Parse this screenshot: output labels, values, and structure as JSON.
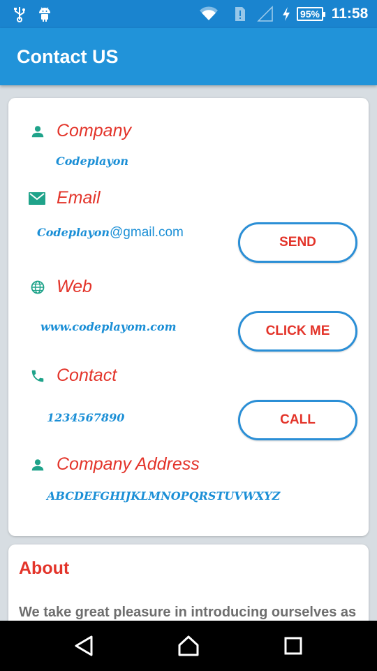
{
  "status_bar": {
    "battery": "95%",
    "time": "11:58"
  },
  "app_bar": {
    "title": "Contact US"
  },
  "contact_card": {
    "company": {
      "label": "Company",
      "value": "Codeplayon"
    },
    "email": {
      "label": "Email",
      "value_prefix": "Codeplayon",
      "value_suffix": "@gmail.com",
      "button": "SEND"
    },
    "web": {
      "label": "Web",
      "value": "www.codeplayom.com",
      "button": "CLICK ME"
    },
    "contact": {
      "label": "Contact",
      "value": "1234567890",
      "button": "CALL"
    },
    "address": {
      "label": "Company Address",
      "value": "ABCDEFGHIJKLMNOPQRSTUVWXYZ"
    }
  },
  "about_card": {
    "title": "About",
    "text": "We take great pleasure in introducing ourselves as"
  },
  "colors": {
    "app_bar": "#2193d9",
    "status_bar": "#1a84cf",
    "label_red": "#e3342a",
    "value_blue": "#1b8fd6",
    "icon_teal": "#1fa38a"
  }
}
